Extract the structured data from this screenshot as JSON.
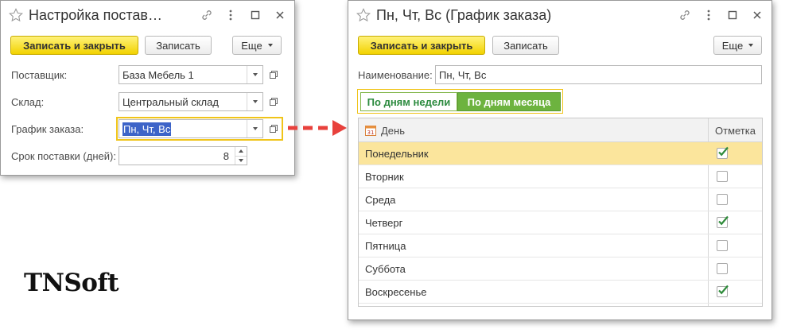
{
  "window_supplier": {
    "title": "Настройка постав…",
    "toolbar": {
      "save_close": "Записать и закрыть",
      "save": "Записать",
      "more": "Еще"
    },
    "fields": {
      "supplier": {
        "label": "Поставщик:",
        "value": "База Мебель 1"
      },
      "warehouse": {
        "label": "Склад:",
        "value": "Центральный склад"
      },
      "schedule": {
        "label": "График заказа:",
        "value": "Пн, Чт, Вс"
      },
      "lead_time": {
        "label": "Срок поставки (дней):",
        "value": "8"
      }
    }
  },
  "window_schedule": {
    "title": "Пн, Чт, Вс (График заказа)",
    "toolbar": {
      "save_close": "Записать и закрыть",
      "save": "Записать",
      "more": "Еще"
    },
    "name": {
      "label": "Наименование:",
      "value": "Пн, Чт, Вс"
    },
    "mode_toggle": {
      "by_week": "По дням недели",
      "by_month": "По дням месяца",
      "active": "by_month"
    },
    "table": {
      "columns": {
        "day": "День",
        "mark": "Отметка"
      },
      "rows": [
        {
          "day": "Понедельник",
          "checked": true,
          "current": true
        },
        {
          "day": "Вторник",
          "checked": false
        },
        {
          "day": "Среда",
          "checked": false
        },
        {
          "day": "Четверг",
          "checked": true
        },
        {
          "day": "Пятница",
          "checked": false
        },
        {
          "day": "Суббота",
          "checked": false
        },
        {
          "day": "Воскресенье",
          "checked": true
        }
      ]
    }
  },
  "logo": {
    "text": "TNSoft"
  },
  "colors": {
    "primary_button": "#f2d200",
    "toggle_active": "#6db33f",
    "arrow": "#e8413c",
    "selection": "#3d64c8",
    "checkmark": "#2e8b3a"
  }
}
